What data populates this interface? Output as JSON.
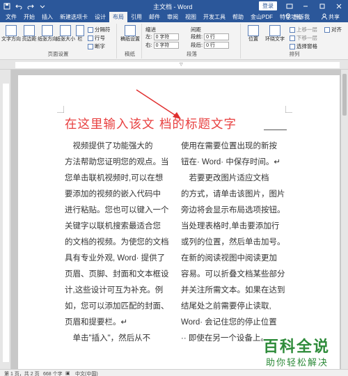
{
  "titlebar": {
    "title": "主文档 - Word",
    "login": "登录",
    "qat": [
      "save-icon",
      "undo-icon",
      "redo-icon",
      "customize-icon"
    ]
  },
  "tabs": [
    "文件",
    "开始",
    "插入",
    "新建选项卡",
    "设计",
    "布局",
    "引用",
    "邮件",
    "审阅",
    "视图",
    "开发工具",
    "帮助",
    "金山PDF",
    "特色功能"
  ],
  "active_tab": "布局",
  "tab_right": {
    "tell_me": "告诉我",
    "share": "共享"
  },
  "ribbon": {
    "page_setup": {
      "label": "页面设置",
      "buttons": [
        "文字方向",
        "页边距",
        "纸张方向",
        "纸张大小",
        "栏"
      ],
      "small": [
        "分隔符",
        "行号",
        "断字"
      ]
    },
    "draft": {
      "label": "稿纸",
      "button": "稿纸设置"
    },
    "paragraph": {
      "label": "段落",
      "indent_head": "缩进",
      "spacing_head": "间距",
      "left_label": "左:",
      "right_label": "右:",
      "before_label": "段前:",
      "after_label": "段后:",
      "left_value": "0 字符",
      "right_value": "0 字符",
      "before_value": "0 行",
      "after_value": "0 行"
    },
    "arrange": {
      "label": "排列",
      "buttons": [
        "位置",
        "环绕文字"
      ],
      "small": [
        "上移一层",
        "下移一层",
        "选择窗格",
        "对齐"
      ]
    }
  },
  "document": {
    "title": "在这里输入该文  档的标题文字",
    "col1": [
      "　视频提供了功能强大的",
      "方法帮助您证明您的观点。当",
      "您单击联机视频时,可以在想",
      "要添加的视频的嵌入代码中",
      "进行粘贴。您也可以键入一个",
      "关键字以联机搜索最适合您",
      "的文档的视频。为使您的文档",
      "具有专业外观, Word· 提供了",
      "页眉、页脚、封面和文本框设",
      "计,这些设计可互为补充。例",
      "如，您可以添加匹配的封面、",
      "页眉和提要栏。↵",
      "　单击\"插入\"，然后从不"
    ],
    "col2": [
      "使用在需要位置出现的新按",
      "钮在· Word· 中保存时间。↵",
      "　若要更改图片适应文档",
      "的方式，请单击该图片，图片",
      "旁边将会显示布局选项按钮。",
      "当处理表格时,单击要添加行",
      "或列的位置，然后单击加号。",
      "在新的阅读视图中阅读更加",
      "容易。可以折叠文档某些部分",
      "并关注所需文本。如果在达到",
      "结尾处之前需要停止读取,",
      "Word· 会记住您的停止位置",
      "·· 即使在另一个设备上。"
    ]
  },
  "status": {
    "page": "第 1 页，共 2 页",
    "words": "668 个字",
    "lang": "中文(中国)"
  },
  "watermark": {
    "main": "百科全说",
    "sub": "助你轻松解决"
  },
  "colors": {
    "accent": "#2b579a",
    "title_red": "#e84040",
    "arrow_red": "#e03030",
    "watermark_green": "#2e8b3a"
  }
}
